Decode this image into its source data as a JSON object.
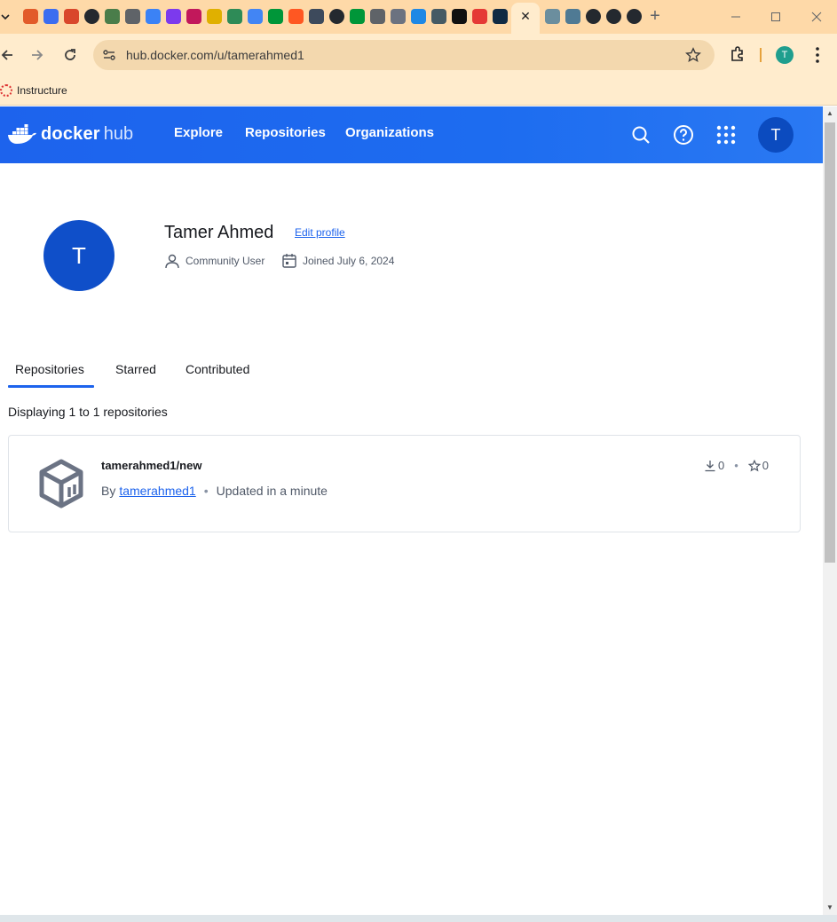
{
  "browser": {
    "url": "hub.docker.com/u/tamerahmed1",
    "profile_initial": "T",
    "bookmark_label": "Instructure",
    "favicon_icons": [
      "ring-icon",
      "c-icon",
      "graduation-icon",
      "github-icon",
      "stack-icon",
      "globe-icon",
      "ring2-icon",
      "pen-icon",
      "image-icon",
      "paint-icon",
      "robot-icon",
      "sparkle-icon",
      "n-icon",
      "blog-icon",
      "vk-icon",
      "github2-icon",
      "n2-icon",
      "globe2-icon",
      "globe3-icon",
      "earth-icon",
      "fish-icon",
      "c2-icon",
      "puzzle-icon",
      "grid-icon",
      "bird-icon",
      "fish2-icon",
      "github3-icon",
      "github4-icon",
      "github5-icon"
    ],
    "colors": {
      "tabstrip": "#fed9a8",
      "toolbar": "#ffeccd"
    }
  },
  "header": {
    "logo_word": "docker",
    "logo_hub": "hub",
    "nav": [
      "Explore",
      "Repositories",
      "Organizations"
    ],
    "avatar_initial": "T",
    "brand_color": "#1d63ed"
  },
  "profile": {
    "initial": "T",
    "name": "Tamer Ahmed",
    "edit_label": "Edit profile",
    "user_type": "Community User",
    "joined": "Joined July 6, 2024"
  },
  "tabs": [
    "Repositories",
    "Starred",
    "Contributed"
  ],
  "active_tab": "Repositories",
  "displaying": "Displaying 1 to 1 repositories",
  "repositories": [
    {
      "name": "tamerahmed1/new",
      "by_prefix": "By",
      "owner": "tamerahmed1",
      "updated": "Updated in a minute",
      "pulls": "0",
      "stars": "0"
    }
  ]
}
